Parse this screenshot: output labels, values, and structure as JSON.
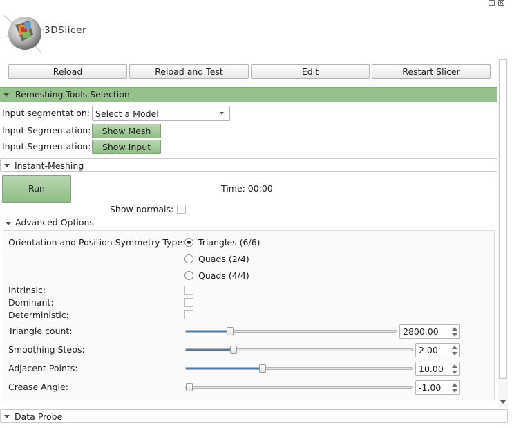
{
  "app": {
    "logo_text": "3DSlicer"
  },
  "toolbar": {
    "reload": "Reload",
    "reload_and_test": "Reload and Test",
    "edit": "Edit",
    "restart": "Restart Slicer"
  },
  "remeshing": {
    "title": "Remeshing Tools Selection",
    "input_label": "Input segmentation:",
    "model_combo": "Select a Model",
    "show_mesh_label": "Input Segmentation:",
    "show_mesh_button": "Show Mesh",
    "show_input_label": "Input Segmentation:",
    "show_input_button": "Show Input"
  },
  "instant": {
    "title": "Instant-Meshing",
    "run_button": "Run",
    "time_label": "Time: 00:00",
    "show_normals_label": "Show normals:",
    "show_normals_checked": false
  },
  "advanced": {
    "title": "Advanced Options",
    "symmetry_label": "Orientation and Position Symmetry Type:",
    "symmetry_options": [
      {
        "label": "Triangles (6/6)",
        "selected": true
      },
      {
        "label": "Quads (2/4)",
        "selected": false
      },
      {
        "label": "Quads (4/4)",
        "selected": false
      }
    ],
    "intrinsic_label": "Intrinsic:",
    "dominant_label": "Dominant:",
    "deterministic_label": "Deterministic:",
    "sliders": [
      {
        "label": "Triangle count:",
        "value": "2800.00",
        "fill_fraction": 0.21
      },
      {
        "label": "Smoothing Steps:",
        "value": "2.00",
        "fill_fraction": 0.21
      },
      {
        "label": "Adjacent Points:",
        "value": "10.00",
        "fill_fraction": 0.34
      },
      {
        "label": "Crease Angle:",
        "value": "-1.00",
        "fill_fraction": 0.0
      }
    ]
  },
  "data_probe": {
    "title": "Data Probe"
  },
  "colors": {
    "section_green": "#94c28a",
    "button_green": "#a6cb9c",
    "slider_fill": "#3d7fc2"
  }
}
